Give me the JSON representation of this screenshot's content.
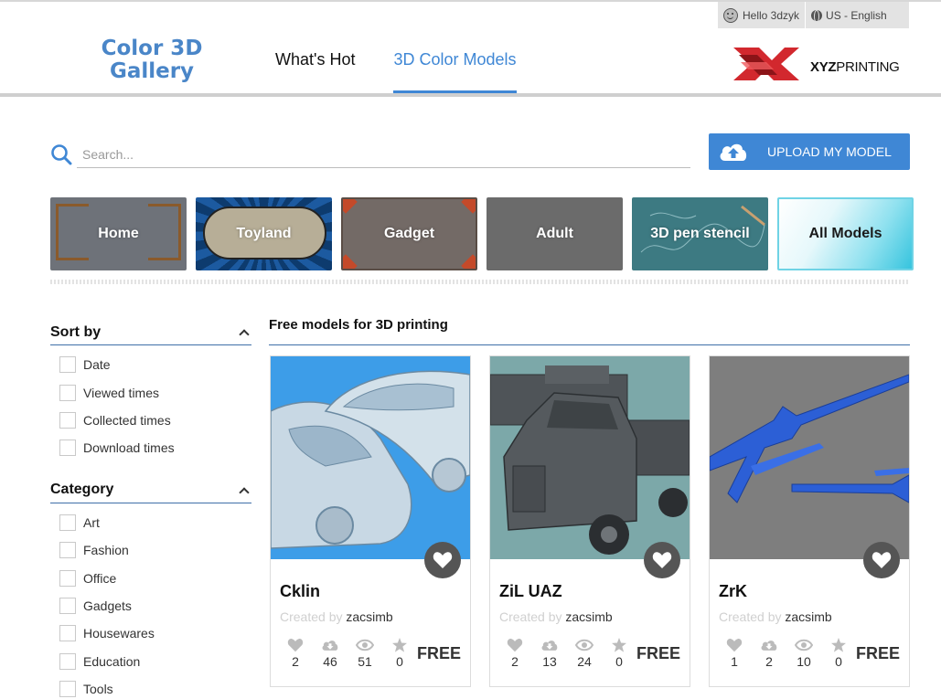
{
  "user_bar": {
    "greeting": "Hello 3dzyk",
    "locale": "US - English"
  },
  "logo": {
    "line1": "Color 3D",
    "line2": "Gallery"
  },
  "nav": [
    {
      "label": "What's Hot",
      "active": false
    },
    {
      "label": "3D Color Models",
      "active": true
    }
  ],
  "brand": {
    "bold": "XYZ",
    "rest": "PRINTING"
  },
  "search": {
    "placeholder": "Search..."
  },
  "upload": {
    "label": "UPLOAD MY MODEL"
  },
  "categories": [
    "Home",
    "Toyland",
    "Gadget",
    "Adult",
    "3D pen stencil",
    "All Models"
  ],
  "sort": {
    "title": "Sort by",
    "options": [
      "Date",
      "Viewed times",
      "Collected times",
      "Download times"
    ]
  },
  "category_filter": {
    "title": "Category",
    "options": [
      "Art",
      "Fashion",
      "Office",
      "Gadgets",
      "Housewares",
      "Education",
      "Tools"
    ]
  },
  "main": {
    "title": "Free models for 3D printing"
  },
  "cards": [
    {
      "title": "Cklin",
      "created_by": "Created by",
      "author": "zacsimb",
      "likes": "2",
      "downloads": "46",
      "views": "51",
      "rating": "0",
      "price": "FREE"
    },
    {
      "title": "ZiL UAZ",
      "created_by": "Created by",
      "author": "zacsimb",
      "likes": "2",
      "downloads": "13",
      "views": "24",
      "rating": "0",
      "price": "FREE"
    },
    {
      "title": "ZrK",
      "created_by": "Created by",
      "author": "zacsimb",
      "likes": "1",
      "downloads": "2",
      "views": "10",
      "rating": "0",
      "price": "FREE"
    }
  ],
  "colors": {
    "accent": "#3f87d5",
    "logo": "#4a86c8",
    "brand_red": "#d2282e"
  }
}
